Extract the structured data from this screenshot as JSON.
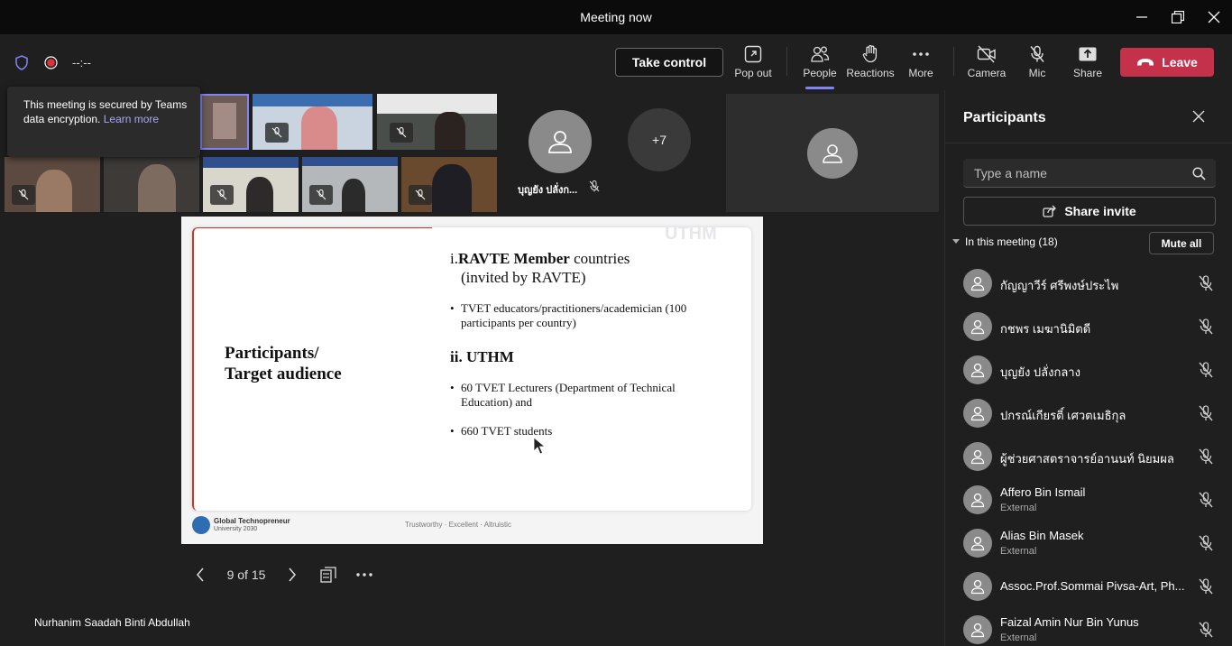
{
  "window": {
    "title": "Meeting now"
  },
  "toolbar": {
    "timer": "--:--",
    "take_control": "Take control",
    "pop_out": "Pop out",
    "people": "People",
    "reactions": "Reactions",
    "more": "More",
    "camera": "Camera",
    "mic": "Mic",
    "share": "Share",
    "leave": "Leave"
  },
  "tooltip": {
    "text": "This meeting is secured by Teams data encryption.",
    "link": "Learn more"
  },
  "video": {
    "participant_tile_name": "บุญยัง ปลั่งก...",
    "overflow_count": "+7"
  },
  "slide": {
    "heading_left": "Participants/ Target audience",
    "section1_num": "i.",
    "section1_bold": "RAVTE Member",
    "section1_rest": "countries",
    "section1_sub": "(invited by RAVTE)",
    "bullet1": "TVET educators/practitioners/academician (100 participants per country)",
    "section2": "ii. UTHM",
    "bullet2": "60 TVET Lecturers (Department of Technical Education) and",
    "bullet3": "660 TVET students",
    "footer_logo": "Global Technopreneur",
    "footer_logo_sub": "University 2030",
    "footer_tagline": "Trustworthy · Excellent · Altruistic",
    "watermark": "UTHM"
  },
  "slide_nav": {
    "page": "9 of 15"
  },
  "presenter": {
    "name": "Nurhanim Saadah Binti Abdullah"
  },
  "panel": {
    "title": "Participants",
    "search_placeholder": "Type a name",
    "share_invite": "Share invite",
    "in_meeting": "In this meeting (18)",
    "mute_all": "Mute all",
    "participants": [
      {
        "name": "กัญญาวีร์ ศรีพงษ์ประไพ",
        "sub": ""
      },
      {
        "name": "กชพร เมฆานิมิตดี",
        "sub": ""
      },
      {
        "name": "บุญยัง ปลั่งกลาง",
        "sub": ""
      },
      {
        "name": "ปกรณ์เกียรติ์ เศวตเมธิกุล",
        "sub": ""
      },
      {
        "name": "ผู้ช่วยศาสตราจารย์อานนท์ นิยมผล",
        "sub": ""
      },
      {
        "name": "Affero Bin Ismail",
        "sub": "External"
      },
      {
        "name": "Alias Bin Masek",
        "sub": "External"
      },
      {
        "name": "Assoc.Prof.Sommai Pivsa-Art, Ph...",
        "sub": ""
      },
      {
        "name": "Faizal Amin Nur Bin Yunus",
        "sub": "External"
      }
    ]
  },
  "colors": {
    "accent": "#7f85f5",
    "leave": "#c4314b",
    "panel_bg": "#1f1f1f",
    "titlebar": "#0b0b0b"
  }
}
